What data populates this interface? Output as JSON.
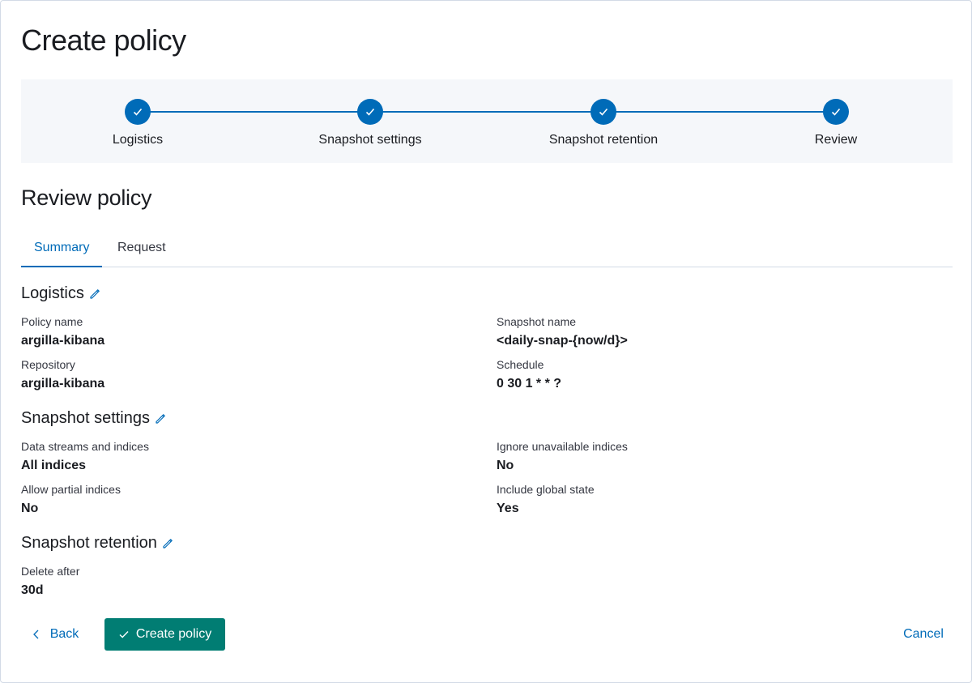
{
  "page": {
    "title": "Create policy"
  },
  "stepper": {
    "steps": [
      {
        "label": "Logistics",
        "status": "complete"
      },
      {
        "label": "Snapshot settings",
        "status": "complete"
      },
      {
        "label": "Snapshot retention",
        "status": "complete"
      },
      {
        "label": "Review",
        "status": "complete"
      }
    ]
  },
  "review": {
    "title": "Review policy",
    "tabs": [
      {
        "label": "Summary",
        "active": true
      },
      {
        "label": "Request",
        "active": false
      }
    ]
  },
  "logistics": {
    "title": "Logistics",
    "policy_name_label": "Policy name",
    "policy_name_value": "argilla-kibana",
    "snapshot_name_label": "Snapshot name",
    "snapshot_name_value": "<daily-snap-{now/d}>",
    "repository_label": "Repository",
    "repository_value": "argilla-kibana",
    "schedule_label": "Schedule",
    "schedule_value": "0 30 1 * * ?"
  },
  "snapshot_settings": {
    "title": "Snapshot settings",
    "indices_label": "Data streams and indices",
    "indices_value": "All indices",
    "ignore_unavailable_label": "Ignore unavailable indices",
    "ignore_unavailable_value": "No",
    "partial_label": "Allow partial indices",
    "partial_value": "No",
    "global_state_label": "Include global state",
    "global_state_value": "Yes"
  },
  "snapshot_retention": {
    "title": "Snapshot retention",
    "delete_after_label": "Delete after",
    "delete_after_value": "30d"
  },
  "footer": {
    "back_label": "Back",
    "create_label": "Create policy",
    "cancel_label": "Cancel"
  },
  "colors": {
    "primary": "#006bb8",
    "success": "#017d73",
    "stepper_bg": "#f5f7fa"
  },
  "icons": {
    "step": "check-icon",
    "edit": "pencil-icon",
    "back": "chevron-left-icon",
    "create": "check-icon"
  }
}
